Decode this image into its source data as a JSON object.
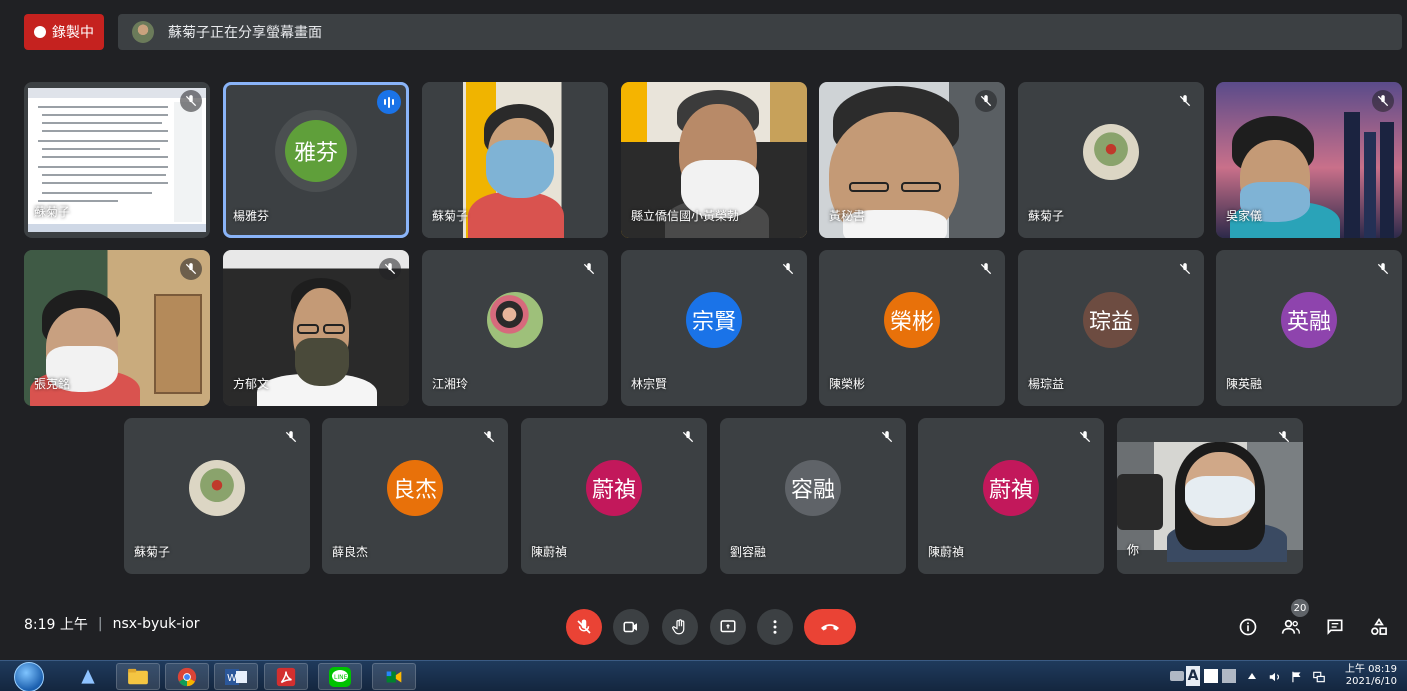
{
  "recording": {
    "label": "錄製中"
  },
  "share_banner": {
    "text": "蘇菊子正在分享螢幕畫面"
  },
  "participants": [
    {
      "name": "蘇菊子",
      "initials": "",
      "muted": true
    },
    {
      "name": "楊雅芬",
      "initials": "雅芬",
      "speaking": true
    },
    {
      "name": "蘇菊子",
      "initials": "",
      "muted": false
    },
    {
      "name": "縣立僑信國小黃榮勃",
      "initials": "",
      "muted": false
    },
    {
      "name": "黃秘書",
      "initials": "",
      "muted": true
    },
    {
      "name": "蘇菊子",
      "initials": "",
      "muted": true
    },
    {
      "name": "吳家儀",
      "initials": "",
      "muted": true
    },
    {
      "name": "張克銘",
      "initials": "",
      "muted": true
    },
    {
      "name": "方郁文",
      "initials": "",
      "muted": true
    },
    {
      "name": "江湘玲",
      "initials": "",
      "muted": true
    },
    {
      "name": "林宗賢",
      "initials": "宗賢",
      "muted": true
    },
    {
      "name": "陳榮彬",
      "initials": "榮彬",
      "muted": true
    },
    {
      "name": "楊琮益",
      "initials": "琮益",
      "muted": true
    },
    {
      "name": "陳英融",
      "initials": "英融",
      "muted": true
    },
    {
      "name": "蘇菊子",
      "initials": "",
      "muted": true
    },
    {
      "name": "薛良杰",
      "initials": "良杰",
      "muted": true
    },
    {
      "name": "陳蔚禎",
      "initials": "蔚禎",
      "muted": true
    },
    {
      "name": "劉容融",
      "initials": "容融",
      "muted": true
    },
    {
      "name": "陳蔚禎",
      "initials": "蔚禎",
      "muted": true
    },
    {
      "name": "你",
      "initials": "",
      "muted": true
    }
  ],
  "avatar_colors": {
    "yafen": "#5f9f3a",
    "zongxian": "#1a73e8",
    "rongbin": "#e8710a",
    "congyi": "#6d4c41",
    "yingrong": "#8e44ad",
    "liangjie": "#e8710a",
    "weizhen": "#c2185b",
    "rongrong": "#5f6368"
  },
  "meeting": {
    "time": "8:19 上午",
    "separator": "|",
    "code": "nsx-byuk-ior"
  },
  "controls": {
    "mic": "mic-off-icon",
    "camera": "videocam-icon",
    "hand": "raise-hand-icon",
    "present": "present-icon",
    "more": "more-vert-icon",
    "leave": "call-end-icon"
  },
  "right_panel": {
    "people_count": "20"
  },
  "taskbar": {
    "apps": [
      "start-icon",
      "explorer-icon",
      "folder-icon",
      "chrome-icon",
      "word-icon",
      "acrobat-icon",
      "line-icon",
      "meet-app-icon"
    ],
    "clock_time": "上午 08:19",
    "clock_date": "2021/6/10",
    "ime": "A"
  }
}
